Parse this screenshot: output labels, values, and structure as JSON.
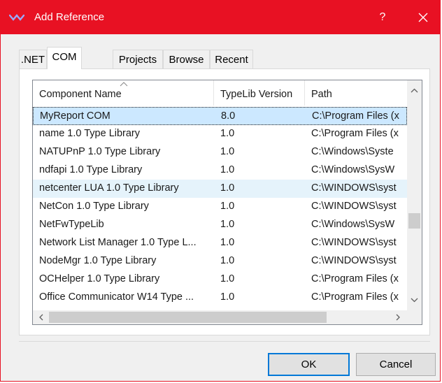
{
  "window": {
    "title": "Add Reference",
    "help_label": "?"
  },
  "tabs": [
    {
      "label": ".NET"
    },
    {
      "label": "COM"
    },
    {
      "label": "Projects"
    },
    {
      "label": "Browse"
    },
    {
      "label": "Recent"
    }
  ],
  "active_tab": "COM",
  "list": {
    "columns": [
      {
        "label": "Component Name"
      },
      {
        "label": "TypeLib Version"
      },
      {
        "label": "Path"
      }
    ],
    "sort_column": "Component Name",
    "rows": [
      {
        "name": "MyReport COM",
        "version": "8.0",
        "path": "C:\\Program Files (x",
        "state": "selected"
      },
      {
        "name": "name 1.0 Type Library",
        "version": "1.0",
        "path": "C:\\Program Files (x",
        "state": ""
      },
      {
        "name": "NATUPnP 1.0 Type Library",
        "version": "1.0",
        "path": "C:\\Windows\\Syste",
        "state": ""
      },
      {
        "name": "ndfapi 1.0 Type Library",
        "version": "1.0",
        "path": "C:\\Windows\\SysW",
        "state": ""
      },
      {
        "name": "netcenter LUA 1.0 Type Library",
        "version": "1.0",
        "path": "C:\\WINDOWS\\syst",
        "state": "hover"
      },
      {
        "name": "NetCon 1.0 Type Library",
        "version": "1.0",
        "path": "C:\\WINDOWS\\syst",
        "state": ""
      },
      {
        "name": "NetFwTypeLib",
        "version": "1.0",
        "path": "C:\\Windows\\SysW",
        "state": ""
      },
      {
        "name": "Network List Manager 1.0 Type L...",
        "version": "1.0",
        "path": "C:\\WINDOWS\\syst",
        "state": ""
      },
      {
        "name": "NodeMgr 1.0 Type Library",
        "version": "1.0",
        "path": "C:\\WINDOWS\\syst",
        "state": ""
      },
      {
        "name": "OCHelper 1.0 Type Library",
        "version": "1.0",
        "path": "C:\\Program Files (x",
        "state": ""
      },
      {
        "name": "Office Communicator W14 Type ...",
        "version": "1.0",
        "path": "C:\\Program Files (x",
        "state": ""
      }
    ]
  },
  "buttons": {
    "ok_label": "OK",
    "cancel_label": "Cancel"
  },
  "colors": {
    "titlebar": "#e81123",
    "selection": "#cce8ff",
    "hover": "#e5f3fb",
    "default_button_border": "#0078d7"
  }
}
